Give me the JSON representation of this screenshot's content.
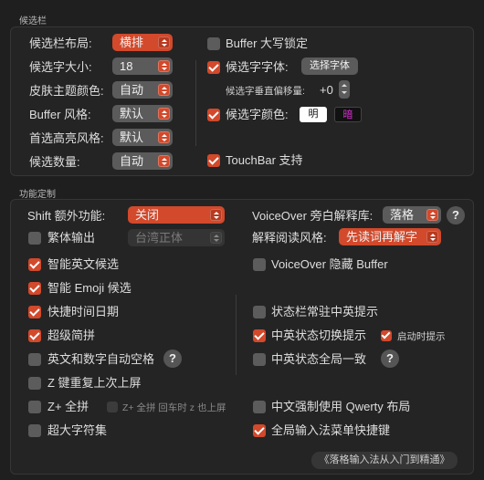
{
  "candidate_bar": {
    "title": "候选栏",
    "layout": {
      "label": "候选栏布局:",
      "value": "横排"
    },
    "font_size": {
      "label": "候选字大小:",
      "value": "18"
    },
    "skin": {
      "label": "皮肤主题颜色:",
      "value": "自动"
    },
    "buffer_style": {
      "label": "Buffer 风格:",
      "value": "默认"
    },
    "highlight_style": {
      "label": "首选高亮风格:",
      "value": "默认"
    },
    "count": {
      "label": "候选数量:",
      "value": "自动"
    },
    "buffer_caps_lock": {
      "label": "Buffer 大写锁定",
      "checked": false
    },
    "candidate_font": {
      "label": "候选字字体:",
      "checked": true,
      "button": "选择字体"
    },
    "vertical_offset": {
      "label": "候选字垂直偏移量:",
      "value": "+0"
    },
    "candidate_color": {
      "label": "候选字颜色:",
      "checked": true,
      "light": "明",
      "dark": "暗",
      "light_color": "#ffffff",
      "dark_color": "#d62fd0"
    },
    "touchbar": {
      "label": "TouchBar 支持",
      "checked": true
    }
  },
  "features": {
    "title": "功能定制",
    "shift_function": {
      "label": "Shift 额外功能:",
      "value": "关闭"
    },
    "voiceover_lib": {
      "label": "VoiceOver 旁白解释库:",
      "value": "落格",
      "help": "?"
    },
    "traditional_output": {
      "label": "繁体输出",
      "checked": false,
      "select_value": "台湾正体"
    },
    "reading_style": {
      "label": "解释阅读风格:",
      "value": "先读词再解字"
    },
    "smart_english": {
      "label": "智能英文候选",
      "checked": true
    },
    "voiceover_hide_buffer": {
      "label": "VoiceOver 隐藏 Buffer",
      "checked": false
    },
    "smart_emoji": {
      "label": "智能 Emoji 候选",
      "checked": true
    },
    "quick_datetime": {
      "label": "快捷时间日期",
      "checked": true
    },
    "status_bar_hint": {
      "label": "状态栏常驻中英提示",
      "checked": false
    },
    "super_jianpin": {
      "label": "超级简拼",
      "checked": true
    },
    "cn_en_switch_hint": {
      "label": "中英状态切换提示",
      "checked": true
    },
    "startup_hint": {
      "label": "启动时提示",
      "checked": true
    },
    "auto_space": {
      "label": "英文和数字自动空格",
      "checked": false,
      "help": "?"
    },
    "global_state": {
      "label": "中英状态全局一致",
      "checked": false,
      "help": "?"
    },
    "z_repeat": {
      "label": "Z 键重复上次上屏",
      "checked": false
    },
    "z_full": {
      "label": "Z+ 全拼",
      "checked": false
    },
    "z_full_enter": {
      "label": "Z+ 全拼 回车时 z 也上屏",
      "checked": false
    },
    "force_qwerty": {
      "label": "中文强制使用 Qwerty 布局",
      "checked": false
    },
    "big_charset": {
      "label": "超大字符集",
      "checked": false
    },
    "global_menu_shortcut": {
      "label": "全局输入法菜单快捷键",
      "checked": true
    },
    "guide_link": "《落格输入法从入门到精通》"
  }
}
